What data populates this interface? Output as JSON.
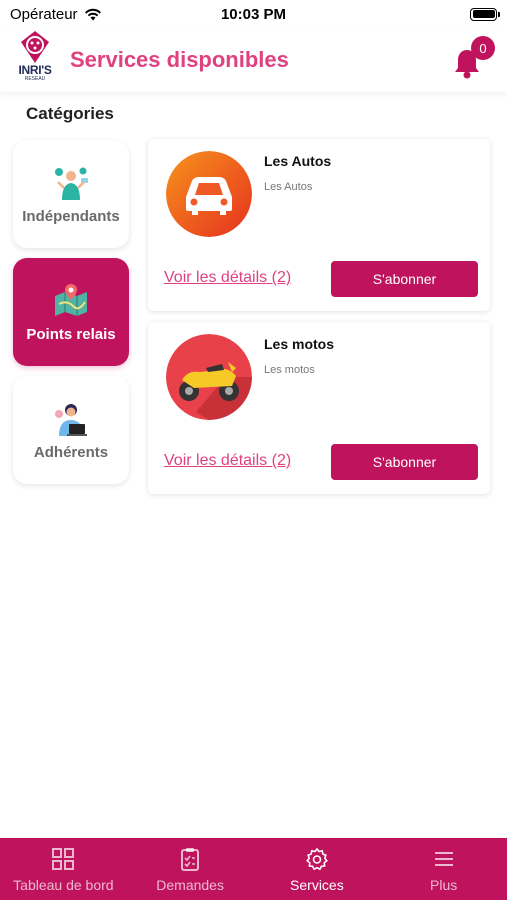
{
  "status": {
    "carrier": "Opérateur",
    "time": "10:03 PM"
  },
  "header": {
    "logo_text": "INRI'S",
    "logo_sub": "RESEAU",
    "title": "Services disponibles",
    "notifications": "0"
  },
  "categories_label": "Catégories",
  "categories": [
    {
      "label": "Indépendants",
      "icon": "person-tech-icon",
      "active": false
    },
    {
      "label": "Points relais",
      "icon": "map-icon",
      "active": true
    },
    {
      "label": "Adhérents",
      "icon": "person-laptop-icon",
      "active": false
    }
  ],
  "services": [
    {
      "title": "Les Autos",
      "subtitle": "Les Autos",
      "link": "Voir les détails (2)",
      "button": "S'abonner",
      "icon": "car-icon"
    },
    {
      "title": "Les motos",
      "subtitle": "Les motos",
      "link": "Voir les détails (2)",
      "button": "S'abonner",
      "icon": "motorcycle-icon"
    }
  ],
  "tabs": [
    {
      "label": "Tableau de bord",
      "icon": "dashboard-icon",
      "active": false
    },
    {
      "label": "Demandes",
      "icon": "clipboard-icon",
      "active": false
    },
    {
      "label": "Services",
      "icon": "gear-icon",
      "active": true
    },
    {
      "label": "Plus",
      "icon": "menu-icon",
      "active": false
    }
  ],
  "colors": {
    "brand": "#c0135d",
    "title": "#e0417f"
  }
}
